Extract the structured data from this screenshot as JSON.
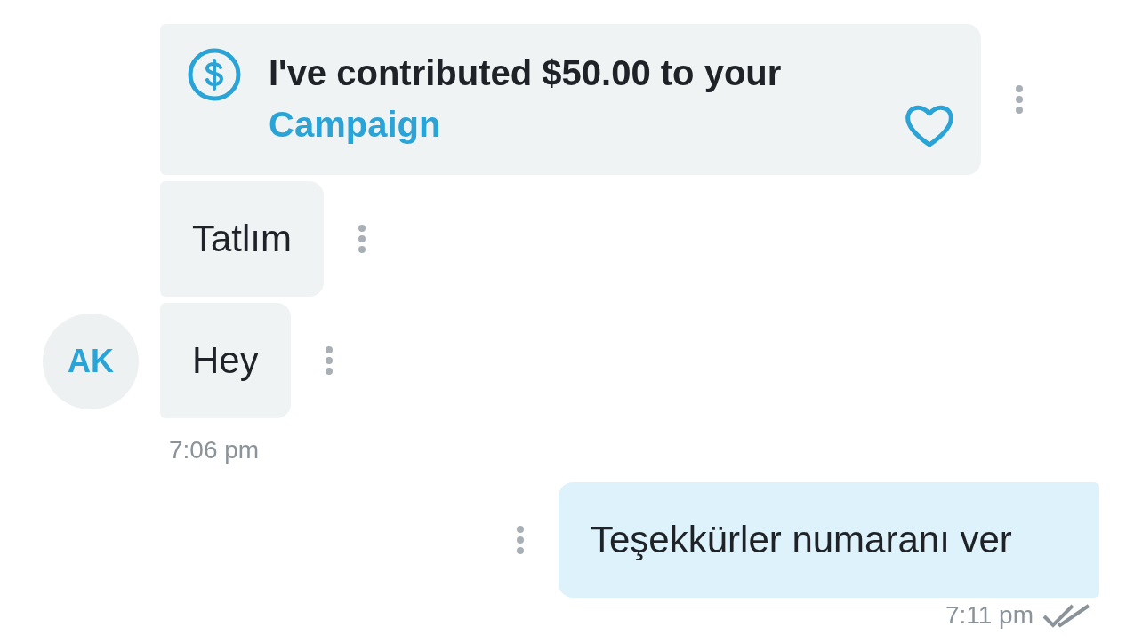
{
  "groups": [
    {
      "kind": "incoming",
      "avatar": "AK",
      "messages": [
        {
          "kind": "contribution",
          "text": "I've contributed $50.00 to your",
          "link": "Campaign"
        },
        {
          "kind": "text",
          "text": "Tatlım"
        },
        {
          "kind": "text",
          "text": "Hey"
        }
      ],
      "time": "7:06 pm"
    },
    {
      "kind": "outgoing",
      "messages": [
        {
          "kind": "text",
          "text": "Teşekkürler numaranı ver"
        }
      ],
      "time": "7:11 pm"
    }
  ]
}
